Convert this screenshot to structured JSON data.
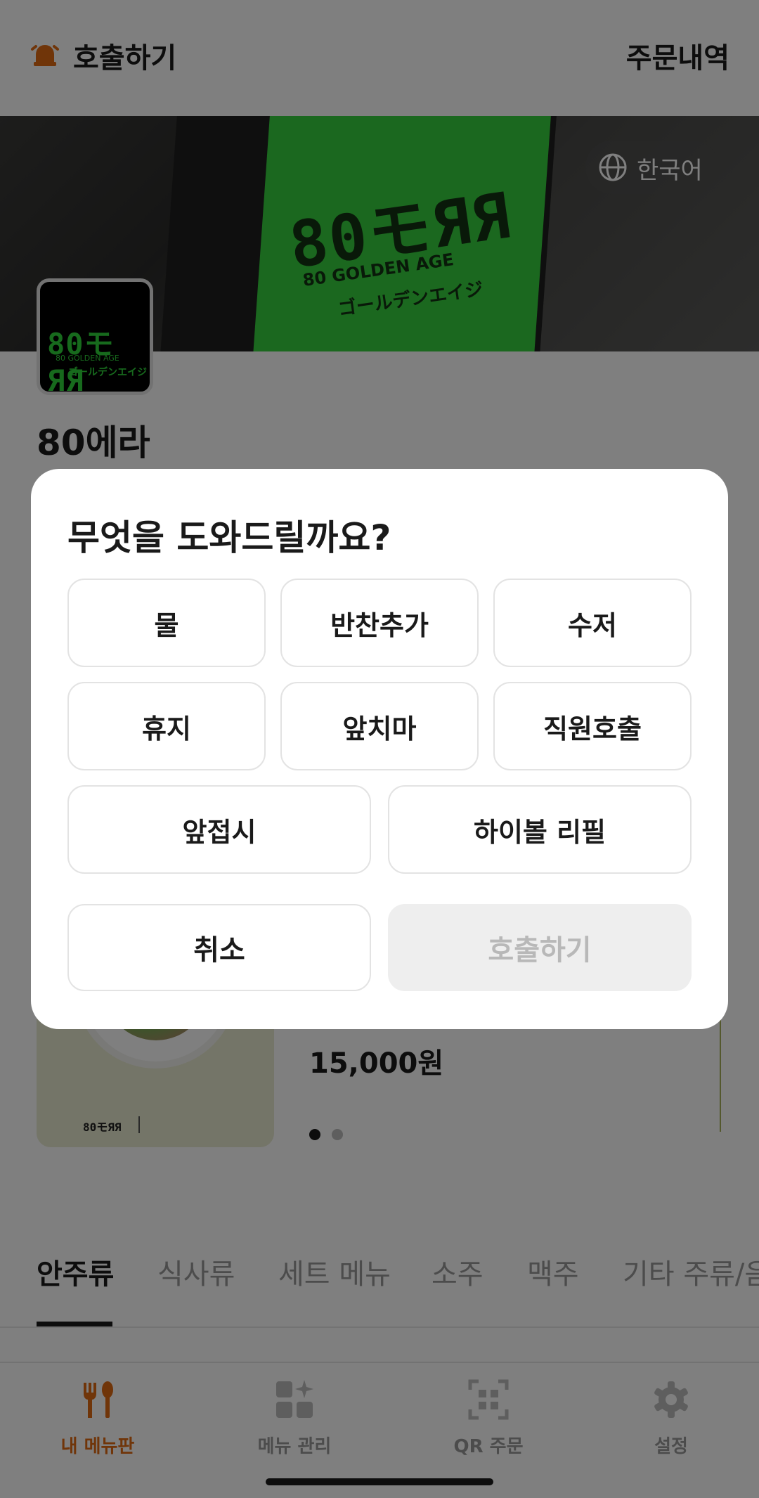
{
  "header": {
    "call_label": "호출하기",
    "orders_label": "주문내역"
  },
  "banner": {
    "sign_text": "80モЯЯ",
    "sign_sub": "80 GOLDEN AGE",
    "sign_jp": "ゴールデンエイジ",
    "language_label": "한국어"
  },
  "store": {
    "logo_text": "80モЯЯ",
    "logo_sub": "80 GOLDEN AGE",
    "logo_jp": "ゴールデンエイジ",
    "name": "80에라"
  },
  "featured": {
    "price": "15,000원",
    "mini_logo": "80モЯЯ",
    "carousel_total": 2,
    "carousel_index": 1
  },
  "tabs": [
    {
      "label": "안주류",
      "active": true
    },
    {
      "label": "식사류",
      "active": false
    },
    {
      "label": "세트 메뉴",
      "active": false
    },
    {
      "label": "소주",
      "active": false
    },
    {
      "label": "맥주",
      "active": false
    },
    {
      "label": "기타 주류/음",
      "active": false
    }
  ],
  "bottom_nav": [
    {
      "label": "내 메뉴판",
      "icon": "fork-spoon-icon",
      "active": true
    },
    {
      "label": "메뉴 관리",
      "icon": "grid-sparkle-icon",
      "active": false
    },
    {
      "label": "QR 주문",
      "icon": "qr-scan-icon",
      "active": false
    },
    {
      "label": "설정",
      "icon": "gear-icon",
      "active": false
    }
  ],
  "modal": {
    "title": "무엇을 도와드릴까요?",
    "options": [
      "물",
      "반찬추가",
      "수저",
      "휴지",
      "앞치마",
      "직원호출",
      "앞접시",
      "하이볼 리필"
    ],
    "cancel_label": "취소",
    "call_label": "호출하기"
  },
  "colors": {
    "accent": "#e06a12",
    "sign_green": "#36d13e",
    "disabled_bg": "#eeeeee",
    "disabled_text": "#b8b8b8"
  }
}
